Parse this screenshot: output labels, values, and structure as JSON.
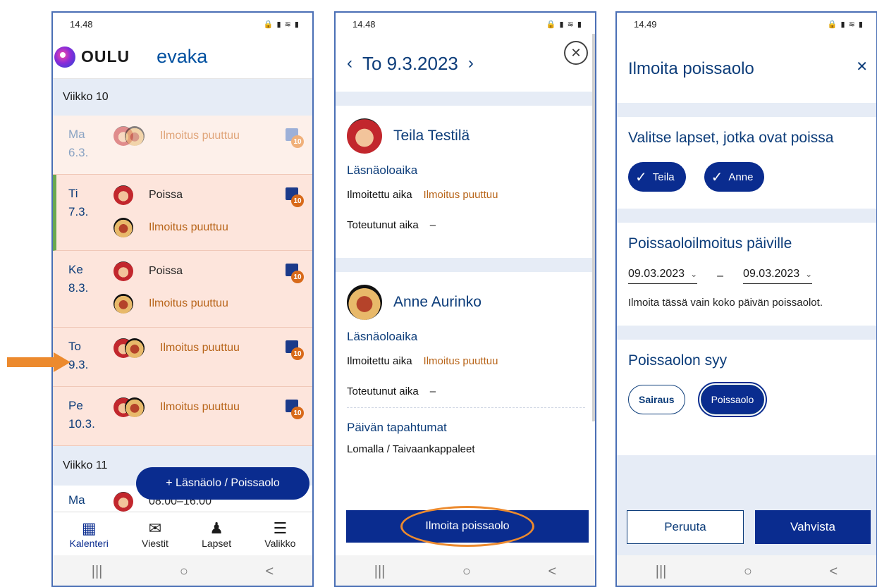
{
  "phone1": {
    "status_time": "14.48",
    "status_right": "🔒 ▮ ≋ ▮",
    "logo_text": "OULU",
    "app_name": "evaka",
    "weeks": [
      {
        "label": "Viikko 10"
      },
      {
        "label": "Viikko 11"
      }
    ],
    "days": [
      {
        "weekday": "Ma",
        "date": "6.3.",
        "entries": [
          {
            "text": "Ilmoitus puuttuu"
          }
        ],
        "badge": "10"
      },
      {
        "weekday": "Ti",
        "date": "7.3.",
        "entries": [
          {
            "text": "Poissa"
          },
          {
            "text": "Ilmoitus puuttuu"
          }
        ],
        "badge": "10"
      },
      {
        "weekday": "Ke",
        "date": "8.3.",
        "entries": [
          {
            "text": "Poissa"
          },
          {
            "text": "Ilmoitus puuttuu"
          }
        ],
        "badge": "10"
      },
      {
        "weekday": "To",
        "date": "9.3.",
        "entries": [
          {
            "text": "Ilmoitus puuttuu"
          }
        ],
        "badge": "10"
      },
      {
        "weekday": "Pe",
        "date": "10.3.",
        "entries": [
          {
            "text": "Ilmoitus puuttuu"
          }
        ],
        "badge": "10"
      },
      {
        "weekday": "Ma",
        "date": "",
        "entries": [
          {
            "text": "08:00–16:00"
          }
        ]
      }
    ],
    "fab_label": "+ Läsnäolo / Poissaolo",
    "nav": [
      {
        "label": "Kalenteri",
        "icon": "calendar-icon"
      },
      {
        "label": "Viestit",
        "icon": "mail-icon"
      },
      {
        "label": "Lapset",
        "icon": "child-icon"
      },
      {
        "label": "Valikko",
        "icon": "menu-icon"
      }
    ]
  },
  "phone2": {
    "status_time": "14.48",
    "status_right": "🔒 ▮ ≋ ▮",
    "date_title": "To 9.3.2023",
    "children": [
      {
        "name": "Teila Testilä",
        "section": "Läsnäoloaika",
        "reported_label": "Ilmoitettu aika",
        "reported_value": "Ilmoitus puuttuu",
        "actual_label": "Toteutunut aika",
        "actual_value": "–"
      },
      {
        "name": "Anne Aurinko",
        "section": "Läsnäoloaika",
        "reported_label": "Ilmoitettu aika",
        "reported_value": "Ilmoitus puuttuu",
        "actual_label": "Toteutunut aika",
        "actual_value": "–"
      }
    ],
    "events_title": "Päivän tapahtumat",
    "events_cut": "Lomalla / Taivaankappaleet",
    "button_label": "Ilmoita poissaolo"
  },
  "phone3": {
    "status_time": "14.49",
    "status_right": "🔒 ▮ ≋ ▮",
    "title": "Ilmoita poissaolo",
    "select_children_title": "Valitse lapset, jotka ovat poissa",
    "children_chips": [
      "Teila",
      "Anne"
    ],
    "dates_title": "Poissaoloilmoitus päiville",
    "start_date": "09.03.2023",
    "end_date": "09.03.2023",
    "dash": "–",
    "info": "Ilmoita tässä vain koko päivän poissaolot.",
    "reason_title": "Poissaolon syy",
    "reasons": [
      "Sairaus",
      "Poissaolo"
    ],
    "cancel_label": "Peruuta",
    "confirm_label": "Vahvista"
  },
  "sysnav": {
    "recents": "|||",
    "home": "○",
    "back": "<"
  },
  "colors": {
    "primary": "#0a2c8f",
    "highlight": "#ec8a2e",
    "missing": "#b8651a"
  }
}
